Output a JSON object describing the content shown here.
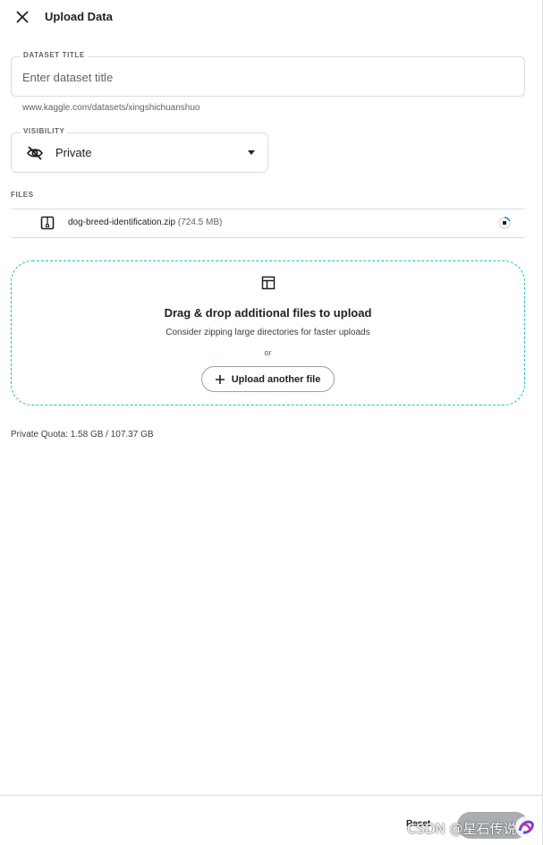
{
  "header": {
    "title": "Upload Data"
  },
  "title_field": {
    "label": "DATASET TITLE",
    "placeholder": "Enter dataset title",
    "value": ""
  },
  "url_hint": "www.kaggle.com/datasets/xingshichuanshuo",
  "visibility": {
    "label": "VISIBILITY",
    "value": "Private"
  },
  "files": {
    "label": "FILES",
    "items": [
      {
        "name": "dog-breed-identification.zip",
        "size": "(724.5 MB)"
      }
    ]
  },
  "dropzone": {
    "title": "Drag & drop additional files to upload",
    "subtitle": "Consider zipping large directories for faster uploads",
    "or": "or",
    "upload_label": "Upload another file"
  },
  "quota": "Private Quota: 1.58 GB / 107.37 GB",
  "footer": {
    "reset_label": "Reset"
  },
  "watermark": "CSDN @星石传说",
  "colors": {
    "dropzone_border": "#20bcd0",
    "text": "#202124",
    "muted": "#5f6368"
  }
}
